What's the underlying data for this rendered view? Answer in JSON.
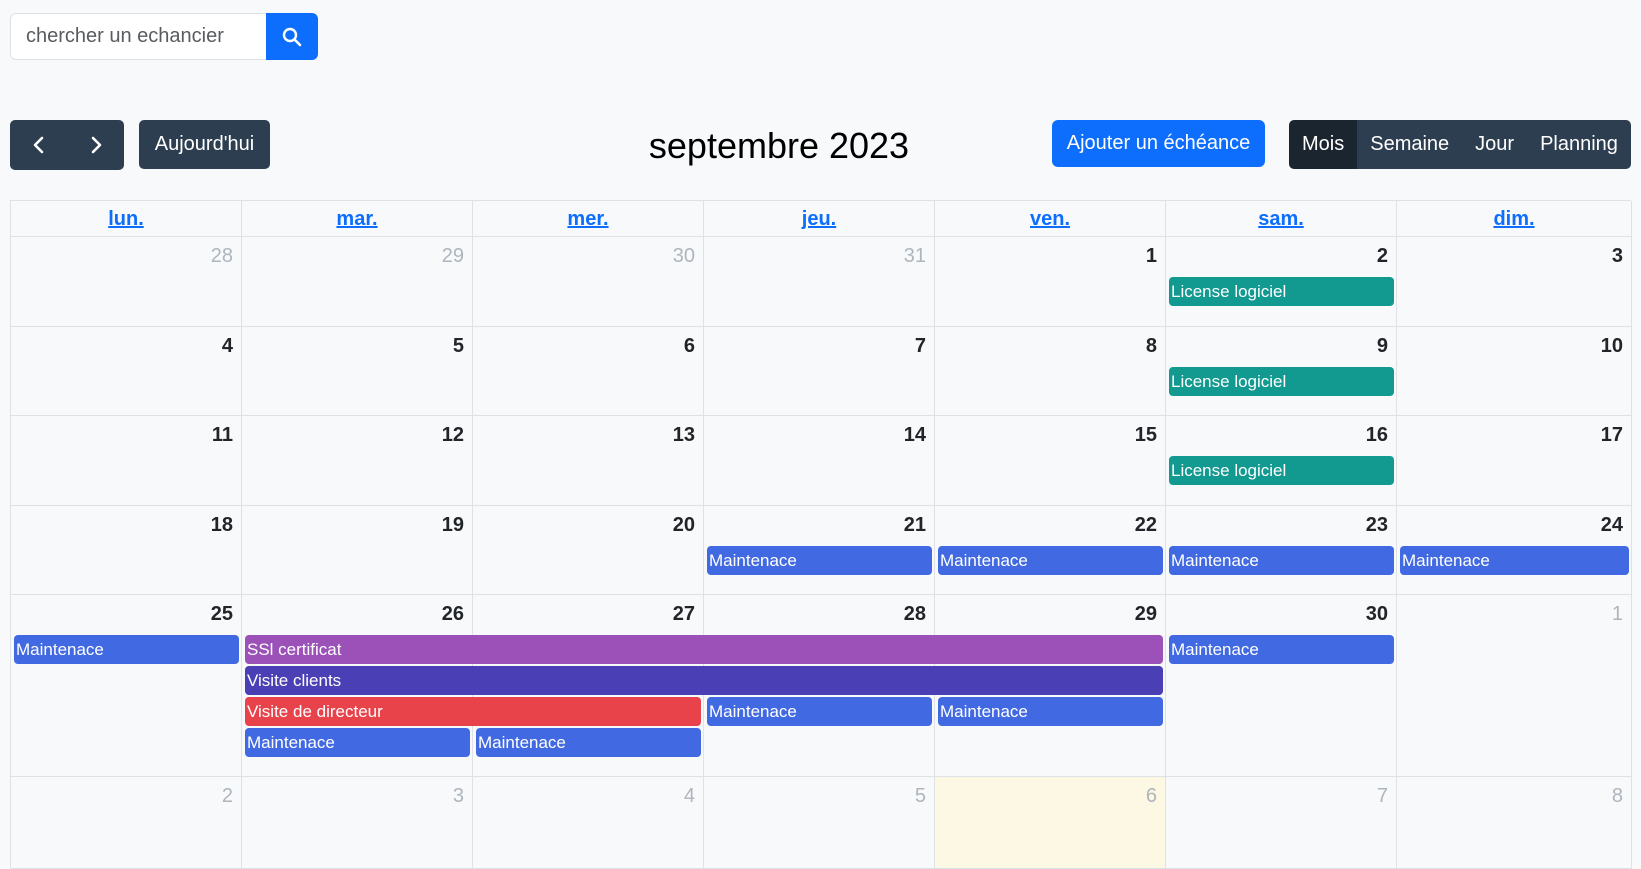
{
  "search": {
    "placeholder": "chercher un echancier"
  },
  "toolbar": {
    "prev_icon": "chevron-left-icon",
    "next_icon": "chevron-right-icon",
    "today_label": "Aujourd'hui",
    "title": "septembre 2023",
    "add_label": "Ajouter un échéance",
    "views": [
      "Mois",
      "Semaine",
      "Jour",
      "Planning"
    ],
    "active_view": "Mois"
  },
  "calendar": {
    "weekdays": [
      "lun.",
      "mar.",
      "mer.",
      "jeu.",
      "ven.",
      "sam.",
      "dim."
    ],
    "weeks": [
      [
        "28",
        "29",
        "30",
        "31",
        "1",
        "2",
        "3"
      ],
      [
        "4",
        "5",
        "6",
        "7",
        "8",
        "9",
        "10"
      ],
      [
        "11",
        "12",
        "13",
        "14",
        "15",
        "16",
        "17"
      ],
      [
        "18",
        "19",
        "20",
        "21",
        "22",
        "23",
        "24"
      ],
      [
        "25",
        "26",
        "27",
        "28",
        "29",
        "30",
        "1"
      ],
      [
        "2",
        "3",
        "4",
        "5",
        "6",
        "7",
        "8"
      ]
    ],
    "events": {
      "license": "License logiciel",
      "maintenance": "Maintenace",
      "ssl": "SSl certificat",
      "visite_clients": "Visite clients",
      "visite_directeur": "Visite de directeur"
    }
  },
  "colors": {
    "primary": "#0d6efd",
    "dark": "#2c3e50",
    "license": "#129a90",
    "maintenance": "#4169e1",
    "ssl": "#9b51b8",
    "visite_clients": "#4b3fb5",
    "visite_directeur": "#e8424b",
    "today_bg": "#fcf8e3"
  }
}
